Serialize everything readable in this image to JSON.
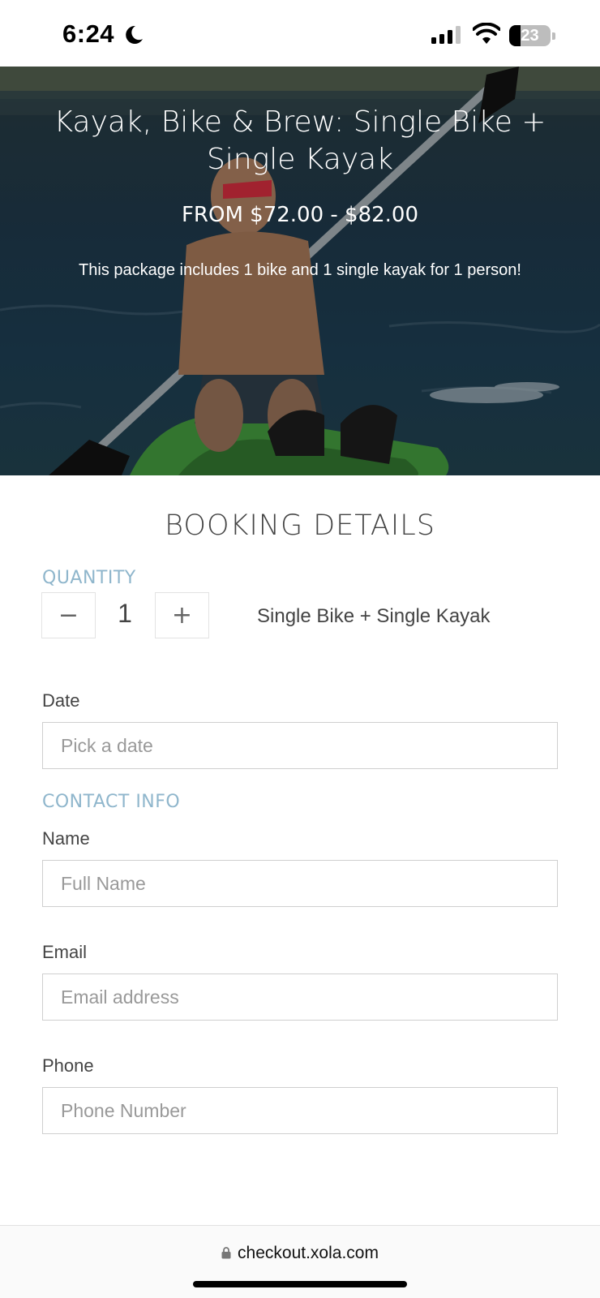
{
  "status_bar": {
    "time": "6:24",
    "battery": "23",
    "icons": [
      "moon-icon",
      "signal-icon",
      "wifi-icon",
      "battery-icon"
    ]
  },
  "hero": {
    "title": "Kayak, Bike & Brew: Single Bike + Single Kayak",
    "price": "FROM $72.00 - $82.00",
    "description": "This package includes 1 bike and 1 single kayak for 1 person!"
  },
  "booking": {
    "title": "BOOKING DETAILS",
    "quantity_label": "QUANTITY",
    "minus_symbol": "−",
    "plus_symbol": "+",
    "quantity_value": "1",
    "item_name": "Single Bike + Single Kayak",
    "date": {
      "label": "Date",
      "placeholder": "Pick a date"
    },
    "contact_label": "CONTACT INFO",
    "name": {
      "label": "Name",
      "placeholder": "Full Name"
    },
    "email": {
      "label": "Email",
      "placeholder": "Email address"
    },
    "phone": {
      "label": "Phone",
      "placeholder": "Phone Number"
    }
  },
  "browser": {
    "url": "checkout.xola.com"
  },
  "colors": {
    "section_accent": "#8fb6cc",
    "text": "#444444",
    "input_border": "#cfcfcf"
  }
}
